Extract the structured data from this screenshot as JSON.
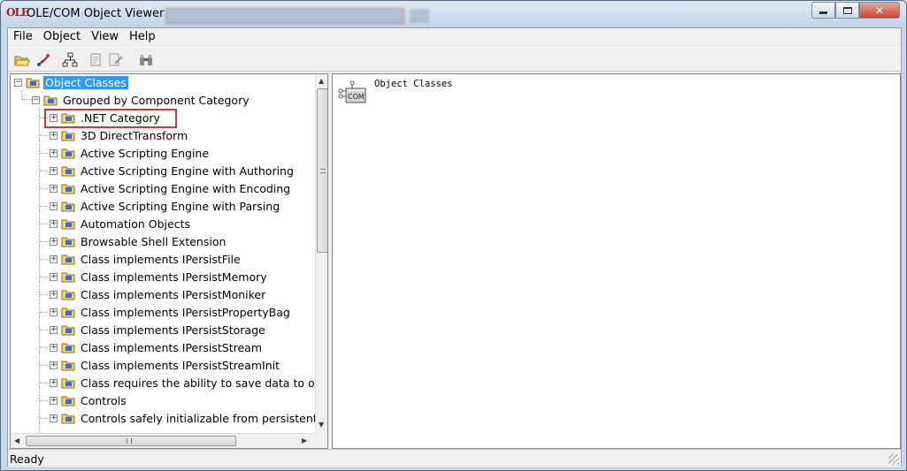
{
  "window": {
    "logo_text": "OLE",
    "title": "OLE/COM Object Viewer",
    "close_glyph": "✕"
  },
  "menu": [
    "File",
    "Object",
    "View",
    "Help"
  ],
  "toolbar": {
    "icons": [
      "open-folder-icon",
      "bind-to-file-icon",
      "view-type-info-icon",
      "copy-clsid-icon",
      "edit-registry-icon",
      "find-icon"
    ]
  },
  "tree": {
    "root": "Object Classes",
    "group": "Grouped by Component Category",
    "items": [
      ".NET Category",
      "3D DirectTransform",
      "Active Scripting Engine",
      "Active Scripting Engine with Authoring",
      "Active Scripting Engine with Encoding",
      "Active Scripting Engine with Parsing",
      "Automation Objects",
      "Browsable Shell Extension",
      "Class implements IPersistFile",
      "Class implements IPersistMemory",
      "Class implements IPersistMoniker",
      "Class implements IPersistPropertyBag",
      "Class implements IPersistStorage",
      "Class implements IPersistStream",
      "Class implements IPersistStreamInit",
      "Class requires the ability to save data to one",
      "Controls",
      "Controls safely initializable from persistent d"
    ],
    "highlighted_item": ".NET Category"
  },
  "detail": {
    "icon_label": "COM",
    "title": "Object Classes"
  },
  "status": {
    "text": "Ready"
  },
  "colors": {
    "selection": "#3399ff",
    "highlight_box": "#d9333f"
  }
}
